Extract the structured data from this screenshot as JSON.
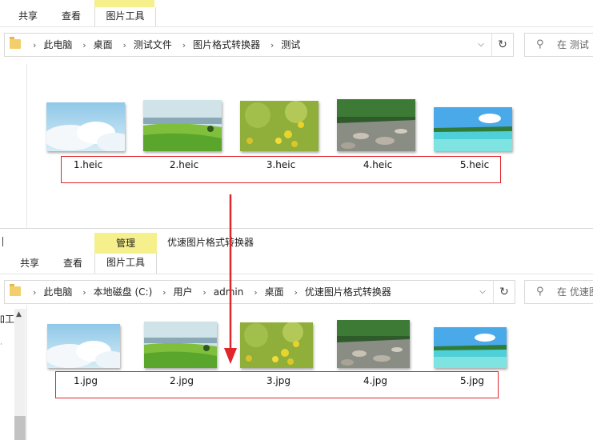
{
  "window1": {
    "tabs": {
      "share": "共享",
      "view": "查看",
      "picture_tools": "图片工具"
    },
    "address": [
      "此电脑",
      "桌面",
      "测试文件",
      "图片格式转换器",
      "测试"
    ],
    "search_placeholder": "在 测试",
    "files": [
      "1.heic",
      "2.heic",
      "3.heic",
      "4.heic",
      "5.heic"
    ]
  },
  "window2": {
    "context_tab": "管理",
    "title": "优速图片格式转换器",
    "tabs": {
      "share": "共享",
      "view": "查看",
      "picture_tools": "图片工具"
    },
    "address": [
      "此电脑",
      "本地磁盘 (C:)",
      "用户",
      "admin",
      "桌面",
      "优速图片格式转换器"
    ],
    "search_placeholder": "在 优速图",
    "nav_fragment": "加工",
    "files": [
      "1.jpg",
      "2.jpg",
      "3.jpg",
      "4.jpg",
      "5.jpg"
    ]
  },
  "icons": [
    "folder-icon",
    "chevron-right-icon",
    "chevron-down-icon",
    "refresh-icon",
    "search-icon",
    "scroll-up-icon",
    "down-arrow-icon"
  ],
  "colors": {
    "context_tab": "#f5f08c",
    "highlight_box": "#e0262b",
    "arrow": "#e0262b"
  }
}
